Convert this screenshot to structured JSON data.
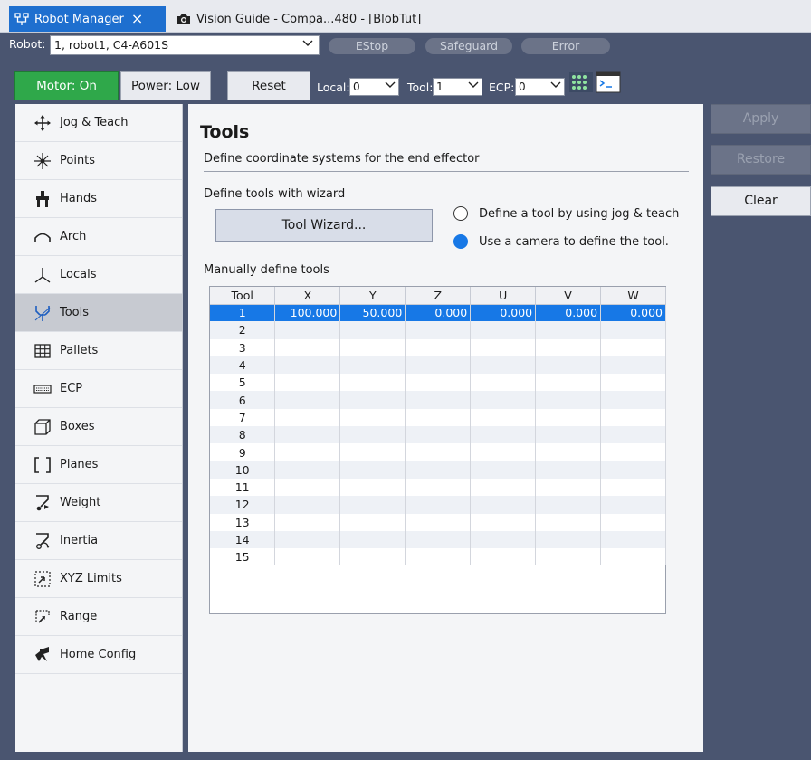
{
  "tabs": [
    {
      "label": "Robot Manager",
      "icon": "robot-manager-icon",
      "active": true
    },
    {
      "label": "Vision Guide - Compa...480 - [BlobTut]",
      "icon": "camera-icon",
      "active": false
    }
  ],
  "robot_bar": {
    "label": "Robot:",
    "selected": "1, robot1, C4-A601S",
    "statuses": [
      "EStop",
      "Safeguard",
      "Error"
    ]
  },
  "controls": {
    "motor": "Motor: On",
    "power": "Power: Low",
    "reset": "Reset",
    "local_label": "Local:",
    "local_value": "0",
    "tool_label": "Tool:",
    "tool_value": "1",
    "ecp_label": "ECP:",
    "ecp_value": "0"
  },
  "sidebar": [
    {
      "label": "Jog & Teach",
      "icon": "jog-arrows-icon"
    },
    {
      "label": "Points",
      "icon": "points-icon"
    },
    {
      "label": "Hands",
      "icon": "hand-icon"
    },
    {
      "label": "Arch",
      "icon": "arch-icon"
    },
    {
      "label": "Locals",
      "icon": "axes-icon"
    },
    {
      "label": "Tools",
      "icon": "tool-icon",
      "selected": true
    },
    {
      "label": "Pallets",
      "icon": "pallet-grid-icon"
    },
    {
      "label": "ECP",
      "icon": "keyboard-icon"
    },
    {
      "label": "Boxes",
      "icon": "box-icon"
    },
    {
      "label": "Planes",
      "icon": "plane-brackets-icon"
    },
    {
      "label": "Weight",
      "icon": "weight-icon"
    },
    {
      "label": "Inertia",
      "icon": "inertia-icon"
    },
    {
      "label": "XYZ Limits",
      "icon": "xyz-limits-icon"
    },
    {
      "label": "Range",
      "icon": "range-icon"
    },
    {
      "label": "Home Config",
      "icon": "home-config-icon"
    }
  ],
  "content": {
    "title": "Tools",
    "subtitle": "Define coordinate systems for the end effector",
    "wizard_section": "Define tools with wizard",
    "wizard_button": "Tool Wizard...",
    "radio_jog": "Define a tool by using jog & teach",
    "radio_camera": "Use a camera to define the tool.",
    "radio_selected": "camera",
    "manual_section": "Manually define tools",
    "table": {
      "headers": [
        "Tool",
        "X",
        "Y",
        "Z",
        "U",
        "V",
        "W"
      ],
      "rows": [
        [
          "1",
          "100.000",
          "50.000",
          "0.000",
          "0.000",
          "0.000",
          "0.000"
        ],
        [
          "2",
          "",
          "",
          "",
          "",
          "",
          ""
        ],
        [
          "3",
          "",
          "",
          "",
          "",
          "",
          ""
        ],
        [
          "4",
          "",
          "",
          "",
          "",
          "",
          ""
        ],
        [
          "5",
          "",
          "",
          "",
          "",
          "",
          ""
        ],
        [
          "6",
          "",
          "",
          "",
          "",
          "",
          ""
        ],
        [
          "7",
          "",
          "",
          "",
          "",
          "",
          ""
        ],
        [
          "8",
          "",
          "",
          "",
          "",
          "",
          ""
        ],
        [
          "9",
          "",
          "",
          "",
          "",
          "",
          ""
        ],
        [
          "10",
          "",
          "",
          "",
          "",
          "",
          ""
        ],
        [
          "11",
          "",
          "",
          "",
          "",
          "",
          ""
        ],
        [
          "12",
          "",
          "",
          "",
          "",
          "",
          ""
        ],
        [
          "13",
          "",
          "",
          "",
          "",
          "",
          ""
        ],
        [
          "14",
          "",
          "",
          "",
          "",
          "",
          ""
        ],
        [
          "15",
          "",
          "",
          "",
          "",
          "",
          ""
        ]
      ],
      "selected_row": 0
    }
  },
  "right_panel": {
    "apply": "Apply",
    "restore": "Restore",
    "clear": "Clear"
  }
}
